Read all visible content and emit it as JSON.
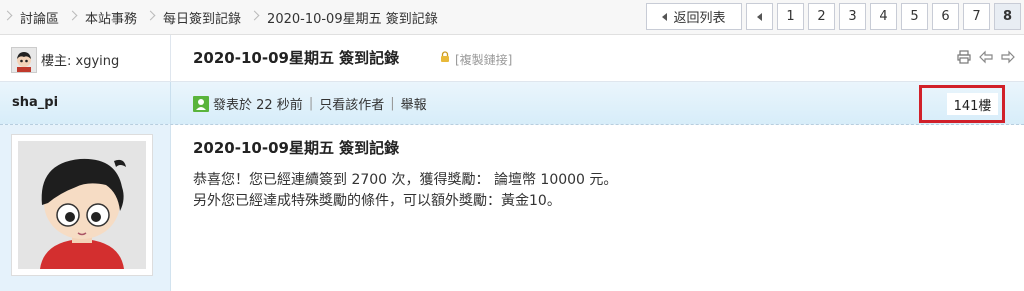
{
  "breadcrumbs": [
    "討論區",
    "本站事務",
    "每日簽到記錄",
    "2020-10-09星期五 簽到記錄"
  ],
  "pager": {
    "back_label": "返回列表",
    "pages": [
      "1",
      "2",
      "3",
      "4",
      "5",
      "6",
      "7",
      "8"
    ],
    "current": "8"
  },
  "thread": {
    "op_label": "樓主: xgying",
    "title": "2020-10-09星期五 簽到記錄",
    "copy_link": "[複製鏈接]"
  },
  "post": {
    "poster": "sha_pi",
    "posted_time": "發表於 22 秒前",
    "only_author": "只看該作者",
    "report": "舉報",
    "floor": "141樓",
    "title": "2020-10-09星期五 簽到記錄",
    "line1": "恭喜您！您已經連續簽到 2700 次，獲得獎勵： 論壇幣 10000 元。",
    "line2": "另外您已經達成特殊獎勵的條件，可以額外獎勵：黃金10。"
  },
  "colors": {
    "highlight": "#d12029",
    "post_bar": "#d7edf9",
    "left_panel": "#e5f2fb"
  }
}
